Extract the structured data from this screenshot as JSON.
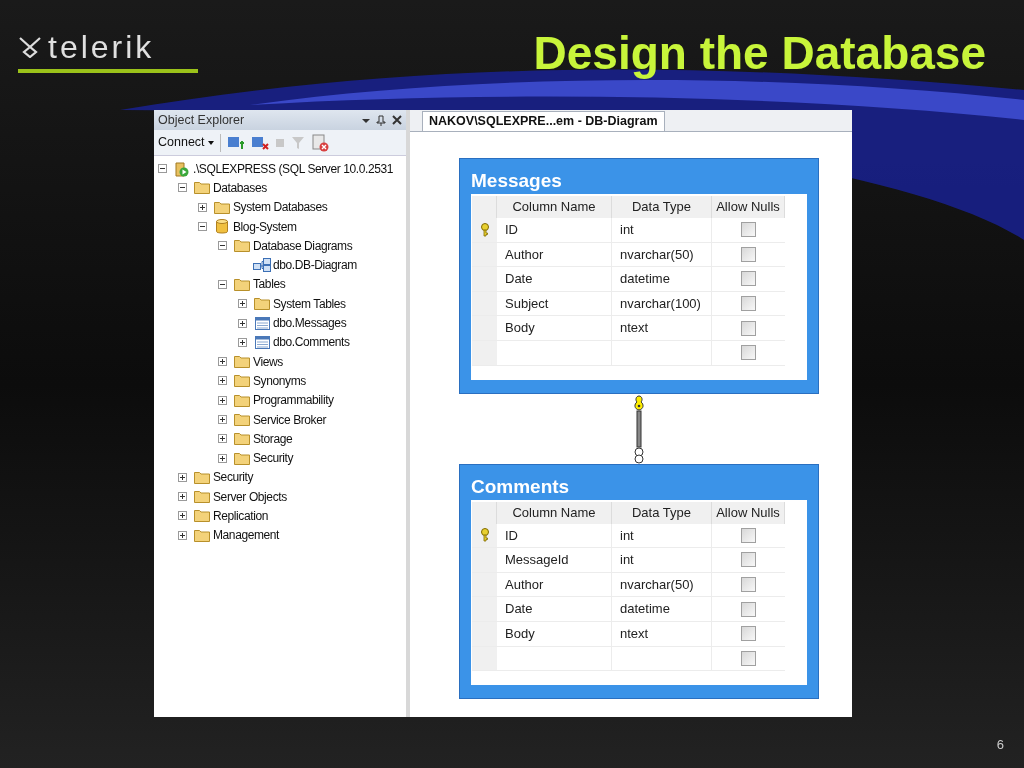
{
  "slide": {
    "logo": "telerik",
    "title": "Design the Database",
    "page_number": "6"
  },
  "object_explorer": {
    "title": "Object Explorer",
    "connect_label": "Connect",
    "tree": [
      {
        "label": ".\\SQLEXPRESS (SQL Server 10.0.2531",
        "kind": "server",
        "expanded": true,
        "children": [
          {
            "label": "Databases",
            "kind": "folder",
            "expanded": true,
            "children": [
              {
                "label": "System Databases",
                "kind": "folder",
                "expanded": false
              },
              {
                "label": "Blog-System",
                "kind": "database",
                "expanded": true,
                "children": [
                  {
                    "label": "Database Diagrams",
                    "kind": "folder",
                    "expanded": true,
                    "children": [
                      {
                        "label": "dbo.DB-Diagram",
                        "kind": "diagram"
                      }
                    ]
                  },
                  {
                    "label": "Tables",
                    "kind": "folder",
                    "expanded": true,
                    "children": [
                      {
                        "label": "System Tables",
                        "kind": "folder",
                        "expanded": false
                      },
                      {
                        "label": "dbo.Messages",
                        "kind": "table",
                        "expanded": false
                      },
                      {
                        "label": "dbo.Comments",
                        "kind": "table",
                        "expanded": false
                      }
                    ]
                  },
                  {
                    "label": "Views",
                    "kind": "folder",
                    "expanded": false
                  },
                  {
                    "label": "Synonyms",
                    "kind": "folder",
                    "expanded": false
                  },
                  {
                    "label": "Programmability",
                    "kind": "folder",
                    "expanded": false
                  },
                  {
                    "label": "Service Broker",
                    "kind": "folder",
                    "expanded": false
                  },
                  {
                    "label": "Storage",
                    "kind": "folder",
                    "expanded": false
                  },
                  {
                    "label": "Security",
                    "kind": "folder",
                    "expanded": false
                  }
                ]
              }
            ]
          },
          {
            "label": "Security",
            "kind": "folder",
            "expanded": false
          },
          {
            "label": "Server Objects",
            "kind": "folder",
            "expanded": false
          },
          {
            "label": "Replication",
            "kind": "folder",
            "expanded": false
          },
          {
            "label": "Management",
            "kind": "folder",
            "expanded": false
          }
        ]
      }
    ]
  },
  "diagram": {
    "tab": "NAKOV\\SQLEXPRE...em - DB-Diagram",
    "tables": [
      {
        "title": "Messages",
        "columns": [
          "Column Name",
          "Data Type",
          "Allow Nulls"
        ],
        "rows": [
          {
            "primary_key": true,
            "name": "ID",
            "type": "int",
            "allow_nulls": false
          },
          {
            "primary_key": false,
            "name": "Author",
            "type": "nvarchar(50)",
            "allow_nulls": false
          },
          {
            "primary_key": false,
            "name": "Date",
            "type": "datetime",
            "allow_nulls": false
          },
          {
            "primary_key": false,
            "name": "Subject",
            "type": "nvarchar(100)",
            "allow_nulls": false
          },
          {
            "primary_key": false,
            "name": "Body",
            "type": "ntext",
            "allow_nulls": false
          },
          {
            "primary_key": false,
            "allow_nulls": false
          }
        ]
      },
      {
        "title": "Comments",
        "columns": [
          "Column Name",
          "Data Type",
          "Allow Nulls"
        ],
        "rows": [
          {
            "primary_key": true,
            "name": "ID",
            "type": "int",
            "allow_nulls": false
          },
          {
            "primary_key": false,
            "name": "MessageId",
            "type": "int",
            "allow_nulls": false
          },
          {
            "primary_key": false,
            "name": "Author",
            "type": "nvarchar(50)",
            "allow_nulls": false
          },
          {
            "primary_key": false,
            "name": "Date",
            "type": "datetime",
            "allow_nulls": false
          },
          {
            "primary_key": false,
            "name": "Body",
            "type": "ntext",
            "allow_nulls": false
          },
          {
            "primary_key": false,
            "allow_nulls": false
          }
        ]
      }
    ]
  }
}
